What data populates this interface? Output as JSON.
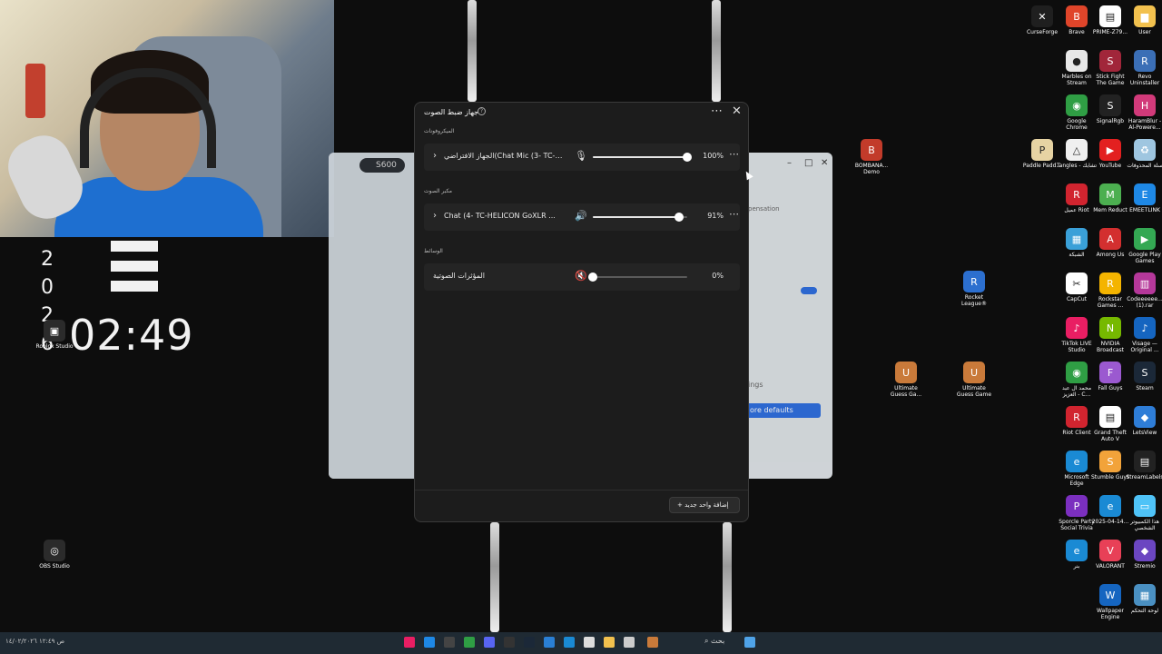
{
  "clock": {
    "time": "02:49",
    "year_digits": [
      "2",
      "0",
      "2",
      "6"
    ],
    "overlay_icon_label": "Roblox Studio"
  },
  "bg_window": {
    "chip": "S600",
    "defaults_button": "ore defaults",
    "left_text": "ings",
    "right_text": "pensation"
  },
  "mixer": {
    "title": "جهاز ضبط الصوت",
    "sections": [
      {
        "label": "الميكروفونات",
        "device": "الجهاز الافتراضي(Chat Mic (3- TC-H...",
        "icon": "microphone-icon",
        "level": 100,
        "percent_text": "100%"
      },
      {
        "label": "مكبر الصوت",
        "device": "Chat (4- TC-HELICON GoXLR ...",
        "icon": "speaker-icon",
        "level": 91,
        "percent_text": "91%"
      },
      {
        "label": "الوسائط",
        "device": "المؤثرات الصوتية",
        "icon": "speaker-muted-icon",
        "level": 0,
        "percent_text": "0%"
      }
    ],
    "add_button": "+ إضافة واحد جديد"
  },
  "desktop_icons": [
    {
      "label": "CurseForge",
      "color": "#1f1f1f",
      "glyph": "✕"
    },
    {
      "label": "Brave",
      "color": "#e0452a",
      "glyph": "B"
    },
    {
      "label": "PRIME-Z79...",
      "color": "#ffffff",
      "glyph": "▤"
    },
    {
      "label": "User",
      "color": "#f2c14e",
      "glyph": "▆"
    },
    {
      "label": "Marbles on Stream",
      "color": "#e8e8e8",
      "glyph": "●"
    },
    {
      "label": "Stick Fight The Game",
      "color": "#a1263a",
      "glyph": "S"
    },
    {
      "label": "Revo Uninstaller",
      "color": "#3b6fb6",
      "glyph": "R"
    },
    {
      "label": "Google Chrome",
      "color": "#2f9e44",
      "glyph": "◉"
    },
    {
      "label": "SignalRgb",
      "color": "#222222",
      "glyph": "S"
    },
    {
      "label": "HaramBlur - Al-Powere...",
      "color": "#d23a7a",
      "glyph": "H"
    },
    {
      "label": "Tangles - تشابك",
      "color": "#f0f0f0",
      "glyph": "△"
    },
    {
      "label": "YouTube",
      "color": "#e32020",
      "glyph": "▶"
    },
    {
      "label": "سلة المحذوفات",
      "color": "#9fc6e0",
      "glyph": "♻"
    },
    {
      "label": "Paddle Padd...",
      "color": "#e6d3a3",
      "glyph": "P"
    },
    {
      "label": "BOMBANA... Demo",
      "color": "#c23b2a",
      "glyph": "B"
    },
    {
      "label": "عميل Riot",
      "color": "#d1242f",
      "glyph": "R"
    },
    {
      "label": "Mem Reduct",
      "color": "#4caf50",
      "glyph": "M"
    },
    {
      "label": "EMEETLINK",
      "color": "#1e88e5",
      "glyph": "E"
    },
    {
      "label": "الشبكة",
      "color": "#3aa0d8",
      "glyph": "▦"
    },
    {
      "label": "Among Us",
      "color": "#d32f2f",
      "glyph": "A"
    },
    {
      "label": "Google Play Games",
      "color": "#34a853",
      "glyph": "▶"
    },
    {
      "label": "Rocket League®",
      "color": "#2c6fcf",
      "glyph": "R"
    },
    {
      "label": "CapCut",
      "color": "#ffffff",
      "glyph": "✂"
    },
    {
      "label": "Rockstar Games ...",
      "color": "#f4b400",
      "glyph": "R"
    },
    {
      "label": "Codeeeeee...(1).rar",
      "color": "#b5389a",
      "glyph": "▥"
    },
    {
      "label": "TikTok LIVE Studio",
      "color": "#e91e63",
      "glyph": "♪"
    },
    {
      "label": "NVIDIA Broadcast",
      "color": "#76b900",
      "glyph": "N"
    },
    {
      "label": "Visage — Original ...",
      "color": "#1565c0",
      "glyph": "♪"
    },
    {
      "label": "Ultimate Guess Ga...",
      "color": "#c97a3a",
      "glyph": "U"
    },
    {
      "label": "Ultimate Guess Game",
      "color": "#c97a3a",
      "glyph": "U"
    },
    {
      "label": "محمد ال عبد العزيز - C...",
      "color": "#2f9e44",
      "glyph": "◉"
    },
    {
      "label": "Fall Guys",
      "color": "#9b59d0",
      "glyph": "F"
    },
    {
      "label": "Steam",
      "color": "#1b2838",
      "glyph": "S"
    },
    {
      "label": "Riot Client",
      "color": "#d1242f",
      "glyph": "R"
    },
    {
      "label": "Grand Theft Auto V",
      "color": "#ffffff",
      "glyph": "▤"
    },
    {
      "label": "LetsView",
      "color": "#2e7dd7",
      "glyph": "◆"
    },
    {
      "label": "Microsoft Edge",
      "color": "#1a8ad4",
      "glyph": "e"
    },
    {
      "label": "Stumble Guys",
      "color": "#f2a33a",
      "glyph": "S"
    },
    {
      "label": "StreamLabels",
      "color": "#222222",
      "glyph": "▤"
    },
    {
      "label": "Sporcle Party Social Trivia",
      "color": "#7b2fbf",
      "glyph": "P"
    },
    {
      "label": "2025-04-14...",
      "color": "#1a8ad4",
      "glyph": "e"
    },
    {
      "label": "هذا الكمبيوتر الشخصي",
      "color": "#4fc3f7",
      "glyph": "▭"
    },
    {
      "label": "OBS Studio",
      "color": "#2b2b2b",
      "glyph": "◎"
    },
    {
      "label": "بنر",
      "color": "#1a8ad4",
      "glyph": "e"
    },
    {
      "label": "VALORANT",
      "color": "#e84057",
      "glyph": "V"
    },
    {
      "label": "Stremio",
      "color": "#6b46c1",
      "glyph": "◆"
    },
    {
      "label": "Wallpaper Engine",
      "color": "#1565c0",
      "glyph": "W"
    },
    {
      "label": "لوحة التحكم",
      "color": "#4a90c2",
      "glyph": "▦"
    }
  ],
  "taskbar": {
    "search_text": "بحث",
    "left_tray": "ص ١٢:٤٩ ١٤/٠٢/٢٠٢٦"
  }
}
